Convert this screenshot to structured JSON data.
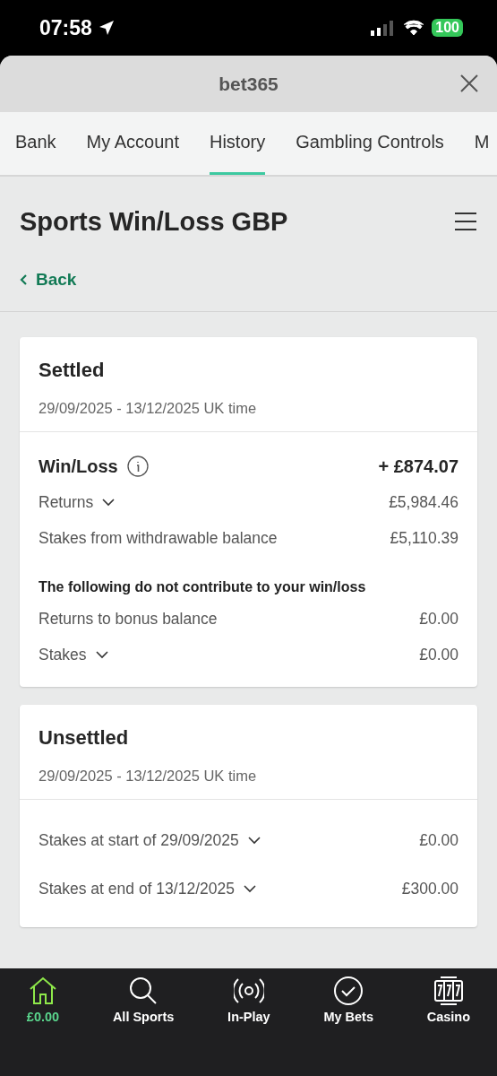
{
  "status_bar": {
    "time": "07:58",
    "battery": "100"
  },
  "sheet": {
    "title": "bet365"
  },
  "tabs": [
    {
      "label": "Bank",
      "selected": false
    },
    {
      "label": "My Account",
      "selected": false
    },
    {
      "label": "History",
      "selected": true
    },
    {
      "label": "Gambling Controls",
      "selected": false
    },
    {
      "label": "M",
      "selected": false
    }
  ],
  "page": {
    "title": "Sports Win/Loss GBP",
    "back": "Back"
  },
  "cards": [
    {
      "title": "Settled",
      "period": "29/09/2025 - 13/12/2025 UK time",
      "rows": [
        {
          "kind": "total",
          "label": "Win/Loss",
          "value": "+ £874.07"
        },
        {
          "kind": "expandable",
          "label": "Returns",
          "value": "£5,984.46"
        },
        {
          "kind": "plain",
          "label": "Stakes from withdrawable balance",
          "value": "£5,110.39"
        },
        {
          "kind": "note",
          "label": "The following do not contribute to your win/loss"
        },
        {
          "kind": "plain",
          "label": "Returns to bonus balance",
          "value": "£0.00"
        },
        {
          "kind": "expandable",
          "label": "Stakes",
          "value": "£0.00"
        }
      ]
    },
    {
      "title": "Unsettled",
      "period": "29/09/2025 - 13/12/2025 UK time",
      "rows": [
        {
          "kind": "expandable",
          "label": "Stakes at start of 29/09/2025",
          "value": "£0.00"
        },
        {
          "kind": "expandable",
          "label": "Stakes at end of 13/12/2025",
          "value": "£300.00"
        }
      ]
    }
  ],
  "nav": [
    {
      "kind": "home",
      "label": "£0.00",
      "selected": true
    },
    {
      "kind": "search",
      "label": "All Sports",
      "selected": false
    },
    {
      "kind": "live",
      "label": "In-Play",
      "selected": false
    },
    {
      "kind": "bets",
      "label": "My Bets",
      "selected": false
    },
    {
      "kind": "casino",
      "label": "Casino",
      "selected": false
    }
  ]
}
